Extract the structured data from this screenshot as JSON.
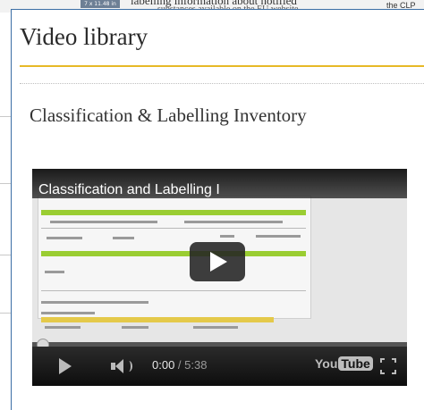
{
  "top_strip": {
    "thumb_label": "7 x 11.48 in",
    "text_line1": "labelling information about notified",
    "text_line2": "substances available on the EU website",
    "right_text": "the CLP"
  },
  "page": {
    "title": "Video library",
    "section_title": "Classification & Labelling Inventory"
  },
  "video": {
    "title": "Classification and Labelling I",
    "current_time": "0:00",
    "separator": " / ",
    "duration": "5:38",
    "logo_you": "You",
    "logo_tube": "Tube",
    "progress_fraction": 0.0
  }
}
